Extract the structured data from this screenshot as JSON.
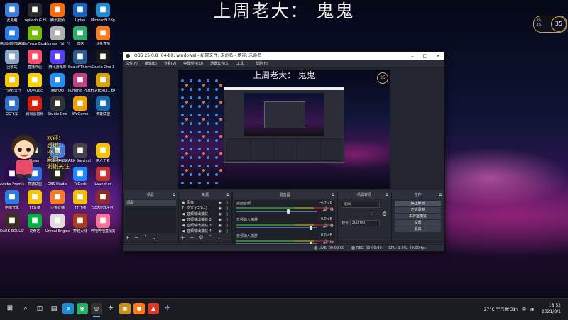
{
  "banner": "上周老大： 鬼鬼",
  "desktop_icons": [
    {
      "label": "此电脑",
      "icon": "computer-icon",
      "color": "#3b7dd8",
      "col": 0,
      "row": 0
    },
    {
      "label": "Logitech G HUB",
      "icon": "logitech-icon",
      "color": "#2a2a2a",
      "col": 1,
      "row": 0
    },
    {
      "label": "腾讯视频",
      "icon": "video-icon",
      "color": "#ff6a00",
      "col": 2,
      "row": 0
    },
    {
      "label": "Uplay",
      "icon": "uplay-icon",
      "color": "#1565c0",
      "col": 3,
      "row": 0
    },
    {
      "label": "Microsoft Edge",
      "icon": "edge-icon",
      "color": "#1f8ad2",
      "col": 4,
      "row": 0
    },
    {
      "label": "腾讯网游加速器",
      "icon": "k-icon",
      "color": "#2b7be4",
      "col": 0,
      "row": 1
    },
    {
      "label": "GeForce Experience",
      "icon": "geforce-icon",
      "color": "#76b900",
      "col": 1,
      "row": 1
    },
    {
      "label": "Human Fall Flat",
      "icon": "game-icon",
      "color": "#b0b0b0",
      "col": 2,
      "row": 1
    },
    {
      "label": "微信",
      "icon": "wechat-icon",
      "color": "#2aae67",
      "col": 3,
      "row": 1
    },
    {
      "label": "斗鱼直播",
      "icon": "douyu-icon",
      "color": "#ff7a1a",
      "col": 4,
      "row": 1
    },
    {
      "label": "回收站",
      "icon": "recycle-icon",
      "color": "#8fa6c0",
      "col": 0,
      "row": 2
    },
    {
      "label": "直播伴侣",
      "icon": "live-icon",
      "color": "#ff4d6a",
      "col": 1,
      "row": 2
    },
    {
      "label": "腾讯游戏库",
      "icon": "tencent-icon",
      "color": "#5a3cff",
      "col": 2,
      "row": 2
    },
    {
      "label": "Sea of Thieves",
      "icon": "ship-icon",
      "color": "#2c5a8a",
      "col": 3,
      "row": 2
    },
    {
      "label": "Studio One 3",
      "icon": "studio-icon",
      "color": "#1a1a1a",
      "col": 4,
      "row": 2
    },
    {
      "label": "YY游戏大厅",
      "icon": "yy-icon",
      "color": "#f7c600",
      "col": 0,
      "row": 3
    },
    {
      "label": "QQMusic",
      "icon": "qqmusic-icon",
      "color": "#f7d300",
      "col": 1,
      "row": 3
    },
    {
      "label": "腾讯QQ",
      "icon": "qq-icon",
      "color": "#1e90ff",
      "col": 2,
      "row": 3
    },
    {
      "label": "Pummel Party",
      "icon": "party-icon",
      "color": "#c04080",
      "col": 3,
      "row": 3
    },
    {
      "label": "PLAYERU... BATTLEG...",
      "icon": "pubg-icon",
      "color": "#d9a400",
      "col": 4,
      "row": 3
    },
    {
      "label": "QQ飞车",
      "icon": "car-icon",
      "color": "#3070c0",
      "col": 0,
      "row": 4
    },
    {
      "label": "网易云音乐",
      "icon": "netease-icon",
      "color": "#d81e06",
      "col": 1,
      "row": 4
    },
    {
      "label": "Studio One",
      "icon": "studio-icon",
      "color": "#333333",
      "col": 2,
      "row": 4
    },
    {
      "label": "WeGame",
      "icon": "wegame-icon",
      "color": "#f0a000",
      "col": 3,
      "row": 4
    },
    {
      "label": "英雄联盟",
      "icon": "lol-icon",
      "color": "#1a6ab0",
      "col": 4,
      "row": 4
    },
    {
      "label": "Steam",
      "icon": "steam-icon",
      "color": "#1b2838",
      "col": 1,
      "row": 6
    },
    {
      "label": "腾讯网游加速",
      "icon": "accel-icon",
      "color": "#3a7de0",
      "col": 2,
      "row": 6
    },
    {
      "label": "ARK Survival Evolved",
      "icon": "ark-icon",
      "color": "#444444",
      "col": 3,
      "row": 6
    },
    {
      "label": "路人王者",
      "icon": "g-icon",
      "color": "#f5c400",
      "col": 4,
      "row": 6
    },
    {
      "label": "Adobe Premiere",
      "icon": "premiere-icon",
      "color": "#2a0a55",
      "col": 0,
      "row": 7
    },
    {
      "label": "高德联盟",
      "icon": "gaode-icon",
      "color": "#2a6ad8",
      "col": 1,
      "row": 7
    },
    {
      "label": "OBS Studio",
      "icon": "obs-icon",
      "color": "#222222",
      "col": 2,
      "row": 7
    },
    {
      "label": "ToDesk",
      "icon": "todesk-icon",
      "color": "#1e88ff",
      "col": 3,
      "row": 7
    },
    {
      "label": "Launcher",
      "icon": "launcher-icon",
      "color": "#c83232",
      "col": 4,
      "row": 7
    },
    {
      "label": "电脑管家",
      "icon": "shield-icon",
      "color": "#2a7de0",
      "col": 0,
      "row": 8
    },
    {
      "label": "YY直播",
      "icon": "yylive-icon",
      "color": "#f7c600",
      "col": 1,
      "row": 8
    },
    {
      "label": "斗鱼直播",
      "icon": "douyu-icon",
      "color": "#ff7a1a",
      "col": 2,
      "row": 8
    },
    {
      "label": "YY开播",
      "icon": "yy-icon",
      "color": "#f0c000",
      "col": 3,
      "row": 8
    },
    {
      "label": "SEX游戏平台",
      "icon": "game-icon",
      "color": "#8a2a2a",
      "col": 4,
      "row": 8
    },
    {
      "label": "DARK SOULS™ III",
      "icon": "darksouls-icon",
      "color": "#3a3020",
      "col": 0,
      "row": 9
    },
    {
      "label": "爱奇艺",
      "icon": "iqiyi-icon",
      "color": "#00b33c",
      "col": 1,
      "row": 9
    },
    {
      "label": "Unreal Engine",
      "icon": "unreal-icon",
      "color": "#dddddd",
      "col": 2,
      "row": 9
    },
    {
      "label": "穿越火线",
      "icon": "cf-icon",
      "color": "#aa3a1a",
      "col": 3,
      "row": 9
    },
    {
      "label": "哔哩哔哩直播姬",
      "icon": "bili-icon",
      "color": "#fb7299",
      "col": 4,
      "row": 9
    }
  ],
  "scroll_text": [
    "欢迎！",
    "感谢...",
    "PK小...",
    "今日...",
    "谢谢关注"
  ],
  "obs": {
    "title": "OBS 25.0.8 (64-bit, windows) - 配置文件: 未命名 - 场景: 未命名",
    "menu": [
      "文件(F)",
      "编辑(E)",
      "查看(V)",
      "停靠部件(D)",
      "场景集合(S)",
      "工具(T)",
      "帮助(H)"
    ],
    "preview_banner": "上周老大： 鬼鬼",
    "docks": {
      "scenes": {
        "title": "场景",
        "items": [
          "场景"
        ]
      },
      "sources": {
        "title": "来源",
        "items": [
          {
            "label": "图像",
            "icon": "image-icon"
          },
          {
            "label": "文本 (GDI+)",
            "icon": "text-icon"
          },
          {
            "label": "音频输出捕获",
            "icon": "speaker-icon"
          },
          {
            "label": "音频输出捕获 2",
            "icon": "speaker-icon"
          },
          {
            "label": "音频输出捕获 3",
            "icon": "speaker-icon"
          },
          {
            "label": "音频输出捕获 4",
            "icon": "speaker-icon"
          }
        ]
      },
      "mixer": {
        "title": "混音器",
        "channels": [
          {
            "name": "桌面音频",
            "db": "-4.7 dB",
            "level": 0.62
          },
          {
            "name": "音频输入捕获",
            "db": "0.0 dB",
            "level": 0.9
          },
          {
            "name": "音频输入捕获",
            "db": "0.0 dB",
            "level": 0.9
          }
        ]
      },
      "transitions": {
        "title": "场景转场",
        "type": "淡出",
        "duration_label": "时长",
        "duration": "300 ms"
      },
      "controls": {
        "title": "控件",
        "buttons": [
          {
            "label": "停止推流",
            "active": true
          },
          {
            "label": "开始录制",
            "active": false
          },
          {
            "label": "工作室模式",
            "active": false
          },
          {
            "label": "设置",
            "active": false
          },
          {
            "label": "退出",
            "active": false
          }
        ]
      }
    },
    "status": {
      "live": "LIVE: 00:00:00",
      "rec": "REC: 00:00:00",
      "cpu": "CPU: 1.9%, 60.00 fps"
    }
  },
  "widget": {
    "value": "35",
    "line1": "1%",
    "line2": "1%"
  },
  "taskbar": {
    "weather": "27°C 空气优 31",
    "sys_icons": "^ ◻ 中 ⊞",
    "time": "18:52",
    "date": "2021/8/1"
  }
}
